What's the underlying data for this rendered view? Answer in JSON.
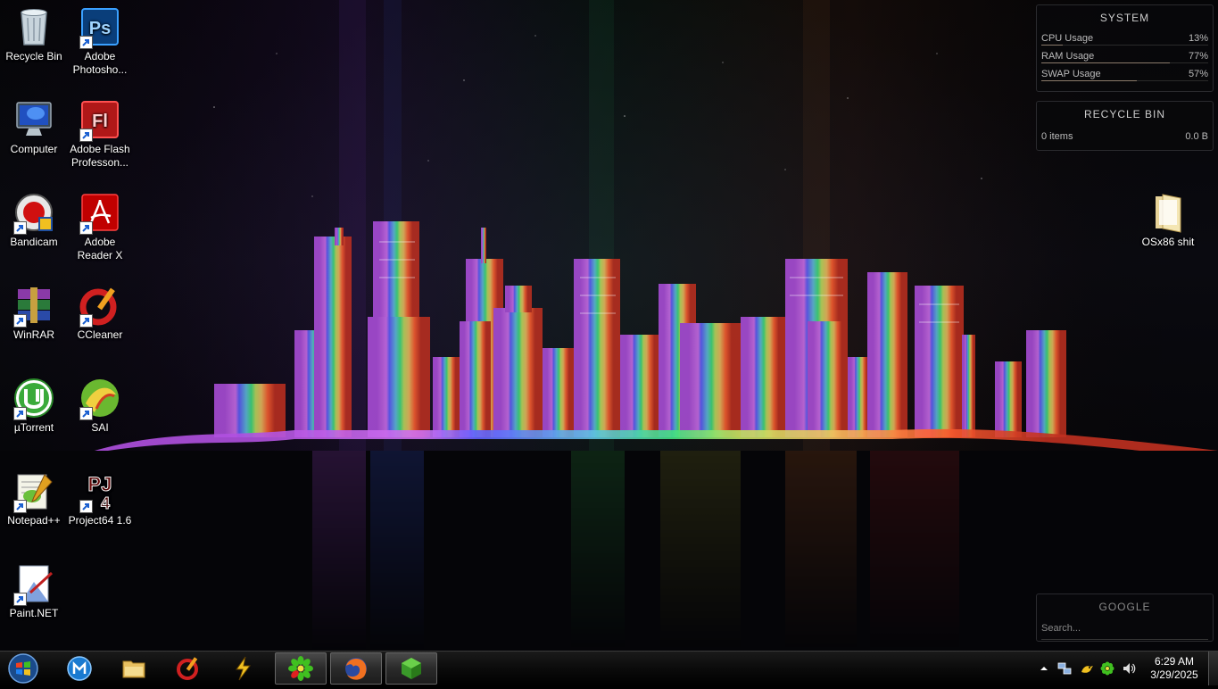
{
  "desktop_icons": [
    {
      "label": "Recycle Bin",
      "icon": "recycle-bin-icon"
    },
    {
      "label": "Adobe Photosho...",
      "icon": "photoshop-icon"
    },
    {
      "label": "Computer",
      "icon": "computer-icon"
    },
    {
      "label": "Adobe Flash Professon...",
      "icon": "flash-icon"
    },
    {
      "label": "Bandicam",
      "icon": "bandicam-icon"
    },
    {
      "label": "Adobe Reader X",
      "icon": "adobe-reader-icon"
    },
    {
      "label": "WinRAR",
      "icon": "winrar-icon"
    },
    {
      "label": "CCleaner",
      "icon": "ccleaner-icon"
    },
    {
      "label": "µTorrent",
      "icon": "utorrent-icon"
    },
    {
      "label": "SAI",
      "icon": "sai-icon"
    },
    {
      "label": "Notepad++",
      "icon": "notepadpp-icon"
    },
    {
      "label": "Project64 1.6",
      "icon": "project64-icon"
    },
    {
      "label": "Paint.NET",
      "icon": "paintnet-icon"
    },
    {
      "label": "OSx86 shit",
      "icon": "folder-icon"
    }
  ],
  "system_gadget": {
    "title": "SYSTEM",
    "rows": [
      {
        "label": "CPU Usage",
        "value": "13%",
        "level": 0.13
      },
      {
        "label": "RAM Usage",
        "value": "77%",
        "level": 0.77
      },
      {
        "label": "SWAP Usage",
        "value": "57%",
        "level": 0.57
      }
    ]
  },
  "recycle_gadget": {
    "title": "RECYCLE BIN",
    "items": "0 items",
    "size": "0.0 B"
  },
  "google_gadget": {
    "title": "GOOGLE",
    "placeholder": "Search..."
  },
  "taskbar": {
    "pinned": [
      {
        "name": "start-button",
        "icon": "windows-orb-icon"
      },
      {
        "name": "maxthon",
        "icon": "maxthon-icon"
      },
      {
        "name": "explorer",
        "icon": "explorer-folder-icon"
      },
      {
        "name": "ccleaner",
        "icon": "ccleaner-icon"
      },
      {
        "name": "winamp",
        "icon": "winamp-icon"
      },
      {
        "name": "icq",
        "icon": "icq-icon"
      },
      {
        "name": "firefox",
        "icon": "firefox-icon"
      },
      {
        "name": "green-cube-app",
        "icon": "cube-icon"
      }
    ],
    "tray": [
      "chevron-up-icon",
      "network-icon",
      "bird-icon",
      "icq-icon",
      "volume-icon"
    ],
    "clock": {
      "time": "6:29 AM",
      "date": "3/29/2025"
    }
  },
  "colors": {
    "purple": "#c050ff",
    "blue": "#4060ff",
    "green": "#40e060",
    "yellow": "#e0e040",
    "orange": "#ff7020",
    "red": "#ff3030"
  }
}
